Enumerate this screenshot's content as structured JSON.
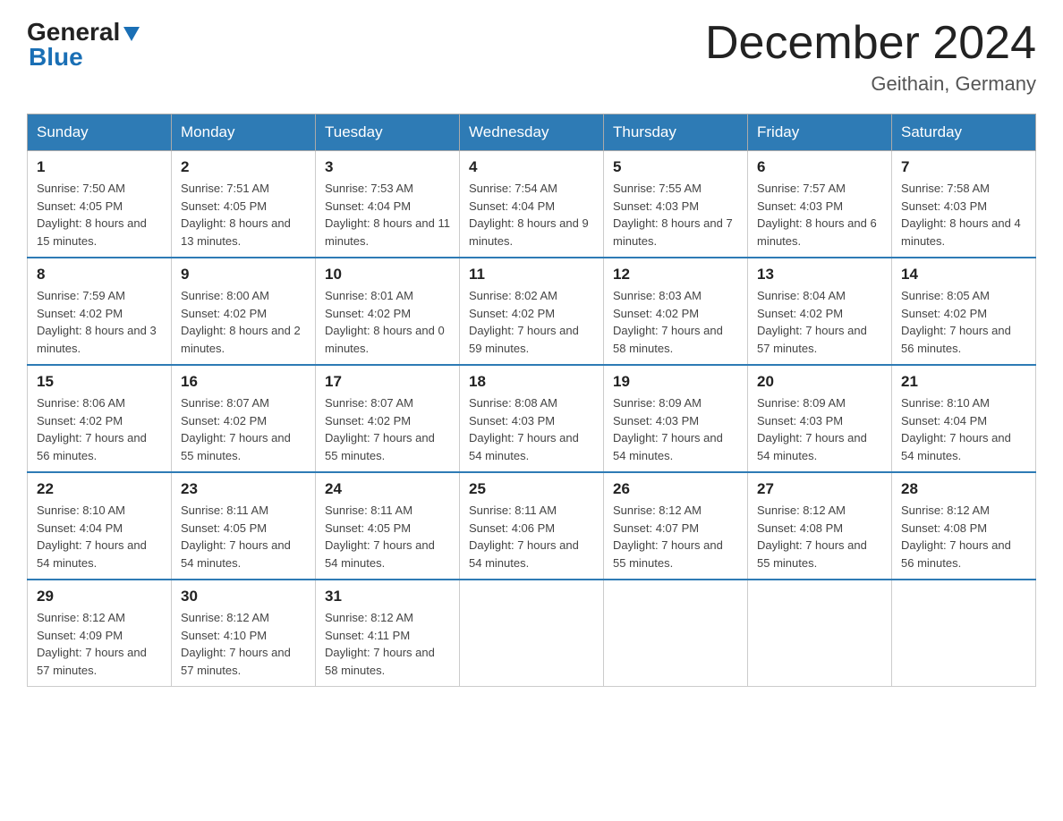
{
  "header": {
    "logo": {
      "general": "General",
      "blue": "Blue"
    },
    "title": "December 2024",
    "subtitle": "Geithain, Germany"
  },
  "days_of_week": [
    "Sunday",
    "Monday",
    "Tuesday",
    "Wednesday",
    "Thursday",
    "Friday",
    "Saturday"
  ],
  "weeks": [
    [
      {
        "day": "1",
        "sunrise": "Sunrise: 7:50 AM",
        "sunset": "Sunset: 4:05 PM",
        "daylight": "Daylight: 8 hours and 15 minutes."
      },
      {
        "day": "2",
        "sunrise": "Sunrise: 7:51 AM",
        "sunset": "Sunset: 4:05 PM",
        "daylight": "Daylight: 8 hours and 13 minutes."
      },
      {
        "day": "3",
        "sunrise": "Sunrise: 7:53 AM",
        "sunset": "Sunset: 4:04 PM",
        "daylight": "Daylight: 8 hours and 11 minutes."
      },
      {
        "day": "4",
        "sunrise": "Sunrise: 7:54 AM",
        "sunset": "Sunset: 4:04 PM",
        "daylight": "Daylight: 8 hours and 9 minutes."
      },
      {
        "day": "5",
        "sunrise": "Sunrise: 7:55 AM",
        "sunset": "Sunset: 4:03 PM",
        "daylight": "Daylight: 8 hours and 7 minutes."
      },
      {
        "day": "6",
        "sunrise": "Sunrise: 7:57 AM",
        "sunset": "Sunset: 4:03 PM",
        "daylight": "Daylight: 8 hours and 6 minutes."
      },
      {
        "day": "7",
        "sunrise": "Sunrise: 7:58 AM",
        "sunset": "Sunset: 4:03 PM",
        "daylight": "Daylight: 8 hours and 4 minutes."
      }
    ],
    [
      {
        "day": "8",
        "sunrise": "Sunrise: 7:59 AM",
        "sunset": "Sunset: 4:02 PM",
        "daylight": "Daylight: 8 hours and 3 minutes."
      },
      {
        "day": "9",
        "sunrise": "Sunrise: 8:00 AM",
        "sunset": "Sunset: 4:02 PM",
        "daylight": "Daylight: 8 hours and 2 minutes."
      },
      {
        "day": "10",
        "sunrise": "Sunrise: 8:01 AM",
        "sunset": "Sunset: 4:02 PM",
        "daylight": "Daylight: 8 hours and 0 minutes."
      },
      {
        "day": "11",
        "sunrise": "Sunrise: 8:02 AM",
        "sunset": "Sunset: 4:02 PM",
        "daylight": "Daylight: 7 hours and 59 minutes."
      },
      {
        "day": "12",
        "sunrise": "Sunrise: 8:03 AM",
        "sunset": "Sunset: 4:02 PM",
        "daylight": "Daylight: 7 hours and 58 minutes."
      },
      {
        "day": "13",
        "sunrise": "Sunrise: 8:04 AM",
        "sunset": "Sunset: 4:02 PM",
        "daylight": "Daylight: 7 hours and 57 minutes."
      },
      {
        "day": "14",
        "sunrise": "Sunrise: 8:05 AM",
        "sunset": "Sunset: 4:02 PM",
        "daylight": "Daylight: 7 hours and 56 minutes."
      }
    ],
    [
      {
        "day": "15",
        "sunrise": "Sunrise: 8:06 AM",
        "sunset": "Sunset: 4:02 PM",
        "daylight": "Daylight: 7 hours and 56 minutes."
      },
      {
        "day": "16",
        "sunrise": "Sunrise: 8:07 AM",
        "sunset": "Sunset: 4:02 PM",
        "daylight": "Daylight: 7 hours and 55 minutes."
      },
      {
        "day": "17",
        "sunrise": "Sunrise: 8:07 AM",
        "sunset": "Sunset: 4:02 PM",
        "daylight": "Daylight: 7 hours and 55 minutes."
      },
      {
        "day": "18",
        "sunrise": "Sunrise: 8:08 AM",
        "sunset": "Sunset: 4:03 PM",
        "daylight": "Daylight: 7 hours and 54 minutes."
      },
      {
        "day": "19",
        "sunrise": "Sunrise: 8:09 AM",
        "sunset": "Sunset: 4:03 PM",
        "daylight": "Daylight: 7 hours and 54 minutes."
      },
      {
        "day": "20",
        "sunrise": "Sunrise: 8:09 AM",
        "sunset": "Sunset: 4:03 PM",
        "daylight": "Daylight: 7 hours and 54 minutes."
      },
      {
        "day": "21",
        "sunrise": "Sunrise: 8:10 AM",
        "sunset": "Sunset: 4:04 PM",
        "daylight": "Daylight: 7 hours and 54 minutes."
      }
    ],
    [
      {
        "day": "22",
        "sunrise": "Sunrise: 8:10 AM",
        "sunset": "Sunset: 4:04 PM",
        "daylight": "Daylight: 7 hours and 54 minutes."
      },
      {
        "day": "23",
        "sunrise": "Sunrise: 8:11 AM",
        "sunset": "Sunset: 4:05 PM",
        "daylight": "Daylight: 7 hours and 54 minutes."
      },
      {
        "day": "24",
        "sunrise": "Sunrise: 8:11 AM",
        "sunset": "Sunset: 4:05 PM",
        "daylight": "Daylight: 7 hours and 54 minutes."
      },
      {
        "day": "25",
        "sunrise": "Sunrise: 8:11 AM",
        "sunset": "Sunset: 4:06 PM",
        "daylight": "Daylight: 7 hours and 54 minutes."
      },
      {
        "day": "26",
        "sunrise": "Sunrise: 8:12 AM",
        "sunset": "Sunset: 4:07 PM",
        "daylight": "Daylight: 7 hours and 55 minutes."
      },
      {
        "day": "27",
        "sunrise": "Sunrise: 8:12 AM",
        "sunset": "Sunset: 4:08 PM",
        "daylight": "Daylight: 7 hours and 55 minutes."
      },
      {
        "day": "28",
        "sunrise": "Sunrise: 8:12 AM",
        "sunset": "Sunset: 4:08 PM",
        "daylight": "Daylight: 7 hours and 56 minutes."
      }
    ],
    [
      {
        "day": "29",
        "sunrise": "Sunrise: 8:12 AM",
        "sunset": "Sunset: 4:09 PM",
        "daylight": "Daylight: 7 hours and 57 minutes."
      },
      {
        "day": "30",
        "sunrise": "Sunrise: 8:12 AM",
        "sunset": "Sunset: 4:10 PM",
        "daylight": "Daylight: 7 hours and 57 minutes."
      },
      {
        "day": "31",
        "sunrise": "Sunrise: 8:12 AM",
        "sunset": "Sunset: 4:11 PM",
        "daylight": "Daylight: 7 hours and 58 minutes."
      },
      null,
      null,
      null,
      null
    ]
  ]
}
